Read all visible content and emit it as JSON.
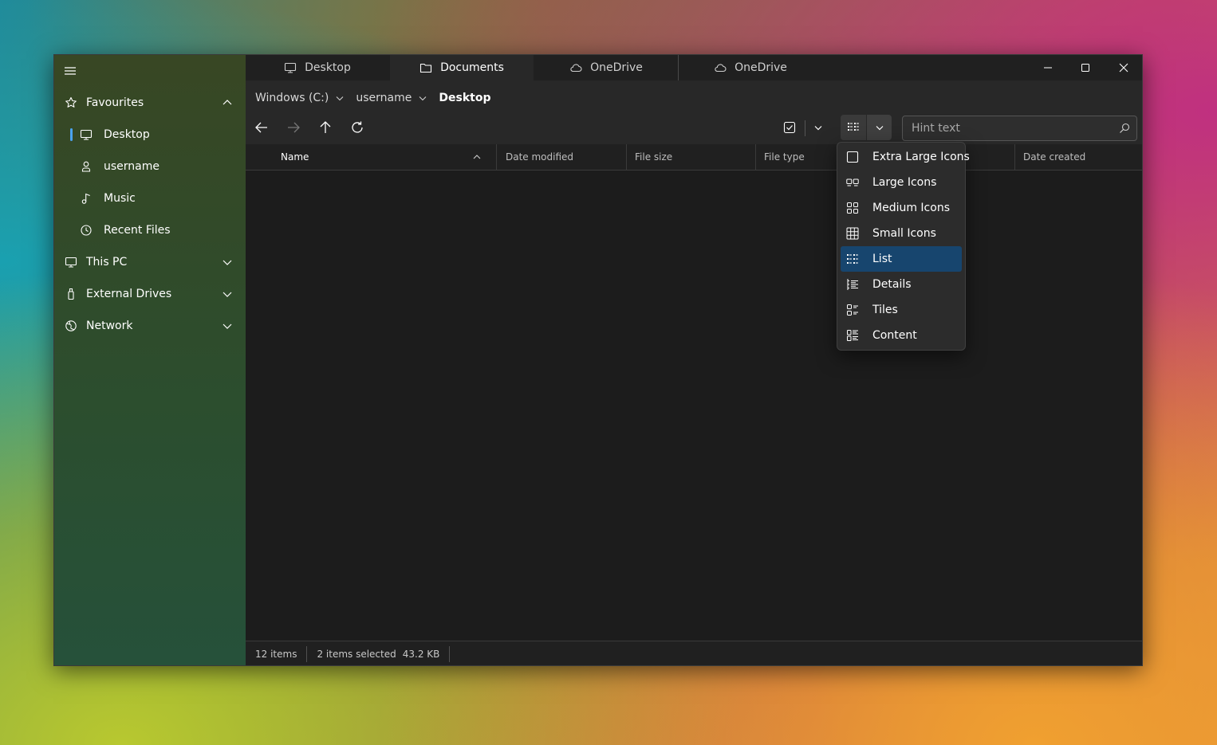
{
  "tabs": [
    {
      "label": "Desktop",
      "icon": "monitor-icon"
    },
    {
      "label": "Documents",
      "icon": "folder-icon",
      "active": true
    },
    {
      "label": "OneDrive",
      "icon": "cloud-icon"
    },
    {
      "label": "OneDrive",
      "icon": "cloud-icon"
    }
  ],
  "sidebar": {
    "items": [
      {
        "label": "Favourites",
        "icon": "star-icon",
        "expanded": true
      },
      {
        "label": "Desktop",
        "icon": "monitor-icon",
        "selected": true
      },
      {
        "label": "username",
        "icon": "person-icon"
      },
      {
        "label": "Music",
        "icon": "music-note-icon"
      },
      {
        "label": "Recent Files",
        "icon": "clock-icon"
      },
      {
        "label": "This PC",
        "icon": "monitor-icon",
        "expanded": false
      },
      {
        "label": "External Drives",
        "icon": "usb-drive-icon",
        "expanded": false
      },
      {
        "label": "Network",
        "icon": "globe-icon",
        "expanded": false
      }
    ]
  },
  "breadcrumb": [
    "Windows (C:)",
    "username",
    "Desktop"
  ],
  "search": {
    "placeholder": "Hint text"
  },
  "columns": [
    "Name",
    "Date modified",
    "File size",
    "File type",
    "Date created"
  ],
  "view_menu": {
    "items": [
      {
        "label": "Extra Large Icons",
        "icon": "square-icon"
      },
      {
        "label": "Large Icons",
        "icon": "large-icons-icon"
      },
      {
        "label": "Medium Icons",
        "icon": "medium-icons-icon"
      },
      {
        "label": "Small Icons",
        "icon": "small-icons-grid-icon"
      },
      {
        "label": "List",
        "icon": "list-view-icon",
        "selected": true
      },
      {
        "label": "Details",
        "icon": "details-view-icon"
      },
      {
        "label": "Tiles",
        "icon": "tiles-view-icon"
      },
      {
        "label": "Content",
        "icon": "content-view-icon"
      }
    ]
  },
  "status": {
    "item_count": "12 items",
    "selection": "2 items selected",
    "selection_size": "43.2 KB"
  },
  "colors": {
    "accent": "#4aa3f0",
    "menu_selected": "#17456e",
    "window_bg": "#202020",
    "list_bg": "#1c1c1c"
  }
}
